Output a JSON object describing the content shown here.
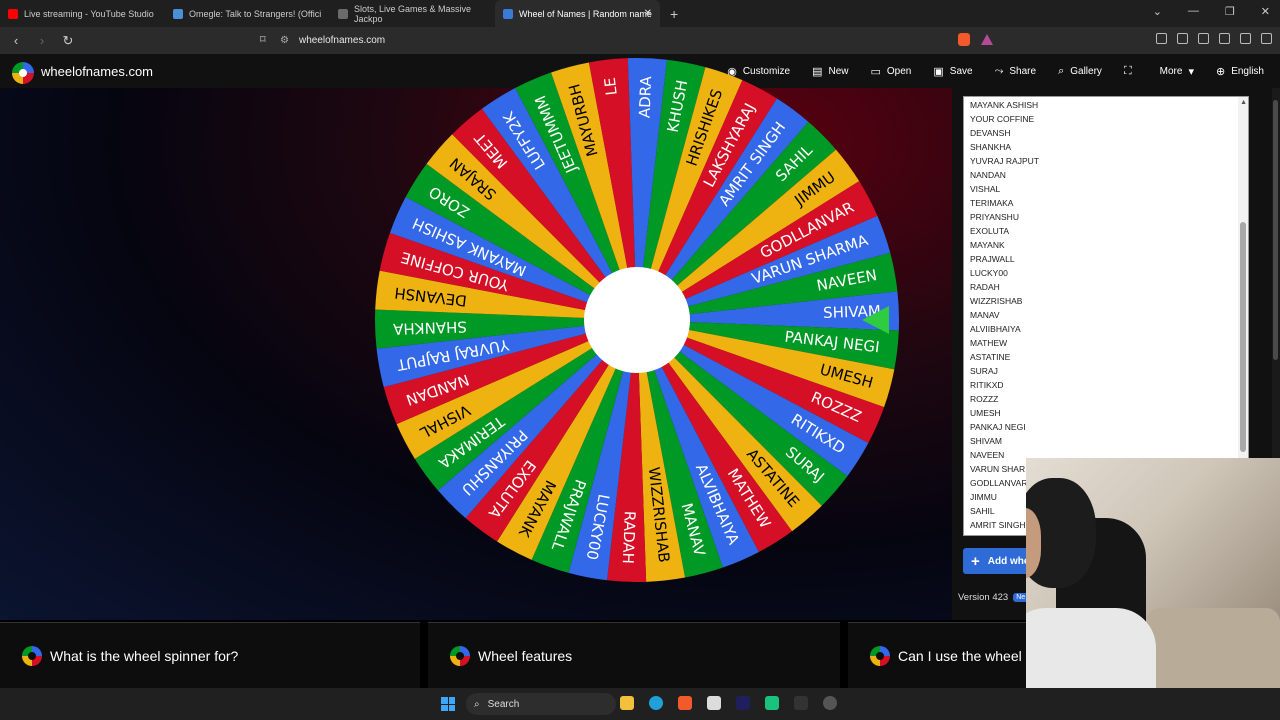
{
  "browser": {
    "tabs": [
      {
        "title": "Live streaming - YouTube Studio",
        "color": "#ff0000",
        "active": false
      },
      {
        "title": "Omegle: Talk to Strangers! (Offici",
        "color": "#4a90d9",
        "active": false
      },
      {
        "title": "Slots, Live Games & Massive Jackpo",
        "color": "#6b6b6b",
        "active": false
      },
      {
        "title": "Wheel of Names | Random name",
        "color": "#3a7bd5",
        "active": true
      }
    ],
    "url": "wheelofnames.com"
  },
  "header": {
    "site_name": "wheelofnames.com",
    "menu": [
      {
        "label": "Customize",
        "icon": "palette-icon",
        "glyph": "◉"
      },
      {
        "label": "New",
        "icon": "new-file-icon",
        "glyph": "▤"
      },
      {
        "label": "Open",
        "icon": "folder-icon",
        "glyph": "▭"
      },
      {
        "label": "Save",
        "icon": "save-icon",
        "glyph": "▣"
      },
      {
        "label": "Share",
        "icon": "share-icon",
        "glyph": "⤳"
      },
      {
        "label": "Gallery",
        "icon": "search-icon",
        "glyph": "⌕"
      },
      {
        "label": "",
        "icon": "fullscreen-icon",
        "glyph": "⛶"
      },
      {
        "label": "More",
        "icon": "chevron-down-icon",
        "glyph": "▾"
      },
      {
        "label": "English",
        "icon": "globe-icon",
        "glyph": "⊕"
      }
    ]
  },
  "wheel": {
    "colors": [
      "#3369e8",
      "#009925",
      "#eeb211",
      "#d50f25"
    ],
    "rotation_deg": 358,
    "pointer_color": "#2ecc40",
    "segments": [
      "SHIVAM",
      "PANKAJ NEGI",
      "UMESH",
      "ROZZZ",
      "RITIKXD",
      "SURAJ",
      "ASTATINE",
      "MATHEW",
      "ALVIBHAIYA",
      "MANAV",
      "WIZZRISHAB",
      "RADAH",
      "LUCKY00",
      "PRAJWALL",
      "MAYANK",
      "EXOLUTA",
      "PRIYANSHU",
      "TERIMAKA",
      "VISHAL",
      "NANDAN",
      "YUVRAJ RAJPUT",
      "SHANKHA",
      "DEVANSH",
      "YOUR COFFINE",
      "MAYANK ASHISH",
      "ZORO",
      "SRAJAN",
      "MEET",
      "LUFFY2K",
      "JEETUMMM",
      "MAYURBH",
      "LE",
      "ADRA",
      "KHUSH",
      "HRISHIKES",
      "LAKSHYARAJ",
      "AMRIT SINGH",
      "SAHIL",
      "JIMMU",
      "GODLLANVAR",
      "VARUN SHARMA",
      "NAVEEN"
    ]
  },
  "entries": {
    "names": [
      "MAYANK ASHISH",
      "YOUR COFFINE",
      "DEVANSH",
      "SHANKHA",
      "YUVRAJ RAJPUT",
      "NANDAN",
      "VISHAL",
      "TERIMAKA",
      "PRIYANSHU",
      "EXOLUTA",
      "MAYANK",
      "PRAJWALL",
      "LUCKY00",
      "RADAH",
      "WIZZRISHAB",
      "MANAV",
      "ALVIIBHAIYA",
      "MATHEW",
      "ASTATINE",
      "SURAJ",
      "RITIKXD",
      "ROZZZ",
      "UMESH",
      "PANKAJ NEGI",
      "SHIVAM",
      "NAVEEN",
      "VARUN SHAR",
      "GODLLANVAR",
      "JIMMU",
      "SAHIL",
      "AMRIT SINGH"
    ],
    "add_button": "Add whee",
    "version": "Version 423",
    "new_badge": "Ne"
  },
  "faq": [
    {
      "label": "What is the wheel spinner for?"
    },
    {
      "label": "Wheel features"
    },
    {
      "label": "Can I use the wheel"
    }
  ],
  "taskbar": {
    "search_placeholder": "Search"
  }
}
